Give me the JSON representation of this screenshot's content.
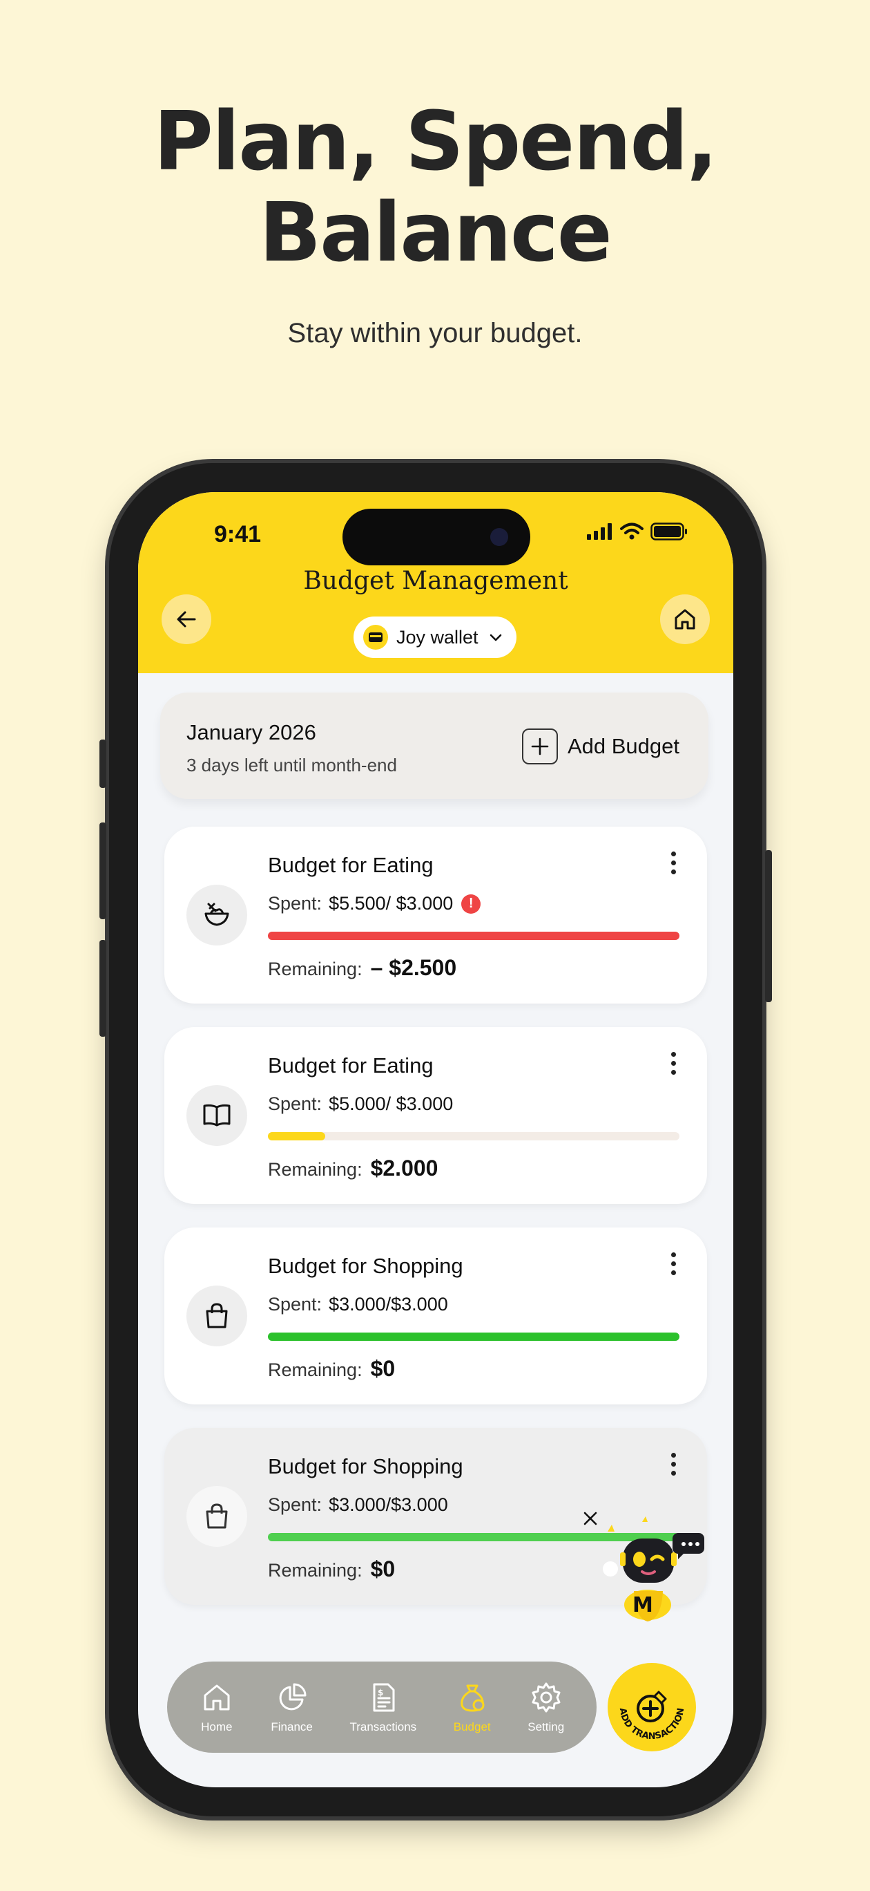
{
  "headline": {
    "line1": "Plan, Spend,",
    "line2": "Balance"
  },
  "subline": "Stay within your budget.",
  "status": {
    "time": "9:41"
  },
  "header": {
    "title": "Budget Management",
    "wallet": "Joy wallet"
  },
  "month": {
    "title": "January 2026",
    "subtitle": "3 days left until month-end",
    "add_label": "Add Budget"
  },
  "budgets": [
    {
      "name": "Budget for Eating",
      "spent_label": "Spent:",
      "spent": "$5.500/ $3.000",
      "remaining_label": "Remaining:",
      "remaining": "– $2.500",
      "progress": 1.0,
      "bar_color": "#ef4444",
      "icon": "salad-bowl-icon",
      "over": true
    },
    {
      "name": "Budget for Eating",
      "spent_label": "Spent:",
      "spent": "$5.000/ $3.000",
      "remaining_label": "Remaining:",
      "remaining": "$2.000",
      "progress": 0.14,
      "bar_color": "#fcd71b",
      "icon": "book-icon",
      "over": false
    },
    {
      "name": "Budget for Shopping",
      "spent_label": "Spent:",
      "spent": "$3.000/$3.000",
      "remaining_label": "Remaining:",
      "remaining": "$0",
      "progress": 1.0,
      "bar_color": "#2cc12c",
      "icon": "shopping-bag-icon",
      "over": false
    },
    {
      "name": "Budget for Shopping",
      "spent_label": "Spent:",
      "spent": "$3.000/$3.000",
      "remaining_label": "Remaining:",
      "remaining": "$0",
      "progress": 1.0,
      "bar_color": "#4fcf4f",
      "icon": "shopping-bag-icon",
      "over": false
    }
  ],
  "nav": {
    "items": [
      {
        "label": "Home",
        "icon": "home-icon"
      },
      {
        "label": "Finance",
        "icon": "pie-chart-icon"
      },
      {
        "label": "Transactions",
        "icon": "receipt-icon"
      },
      {
        "label": "Budget",
        "icon": "money-bag-icon"
      },
      {
        "label": "Setting",
        "icon": "gear-icon"
      }
    ],
    "active": "Budget",
    "fab_label": "ADD TRANSACTION"
  },
  "colors": {
    "background": "#fdf6d6",
    "accent": "#fcd71b",
    "danger": "#ef4444",
    "success": "#2cc12c"
  }
}
